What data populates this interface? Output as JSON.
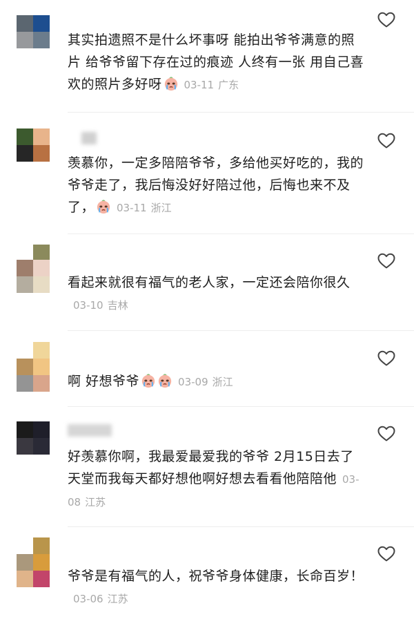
{
  "comments": [
    {
      "text": "其实拍遗照不是什么坏事呀 能拍出爷爷满意的照片 给爷爷留下存在过的痕迹 人终有一张 用自己喜欢的照片多好呀",
      "emoji": "crying-face",
      "date": "03-11",
      "location": "广东"
    },
    {
      "text": "羡慕你，一定多陪陪爷爷，多给他买好吃的，我的爷爷走了，我后悔没好好陪过他，后悔也来不及了，",
      "emoji": "crying-face",
      "date": "03-11",
      "location": "浙江"
    },
    {
      "text": "看起来就很有福气的老人家，一定还会陪你很久",
      "emoji": "",
      "date": "03-10",
      "location": "吉林"
    },
    {
      "text": "啊 好想爷爷",
      "emoji": "crying-face x2",
      "date": "03-09",
      "location": "浙江"
    },
    {
      "text": "好羡慕你啊，我最爱最爱我的爷爷 2月15日去了天堂而我每天都好想他啊好想去看看他陪陪他",
      "emoji": "",
      "date": "03-08",
      "location": "江苏"
    },
    {
      "text": "爷爷是有福气的人，祝爷爷身体健康，长命百岁！",
      "emoji": "",
      "date": "03-06",
      "location": "江苏"
    }
  ],
  "icons": {
    "like": "heart-outline-icon"
  },
  "colors": {
    "text": "#1e1e1e",
    "meta": "#a8a8a8",
    "icon": "#444444"
  }
}
